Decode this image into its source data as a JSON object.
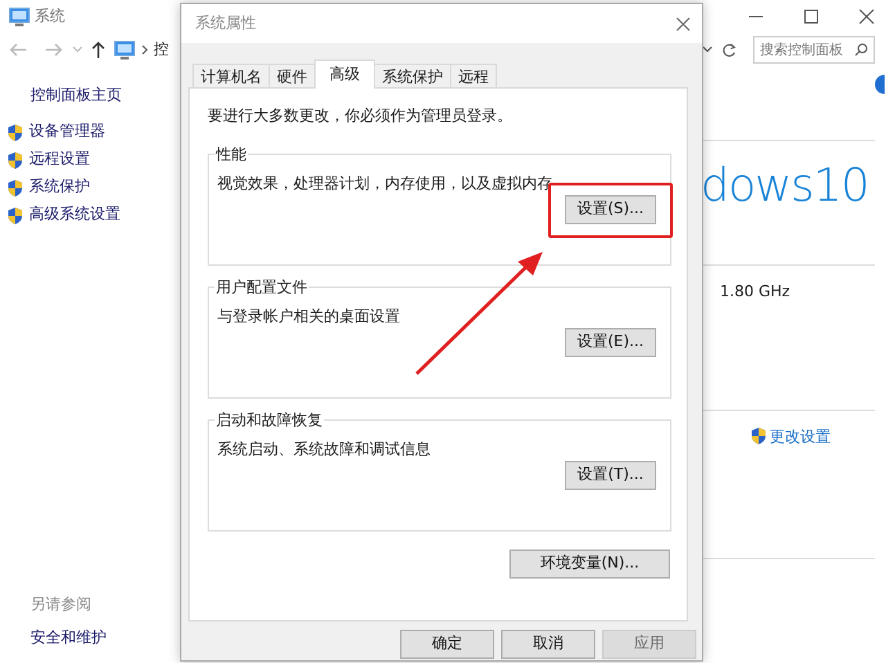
{
  "window": {
    "title": "系统",
    "breadcrumb": "控",
    "search": {
      "placeholder": "搜索控制面板"
    }
  },
  "sidebar": {
    "home": "控制面板主页",
    "items": [
      {
        "label": "设备管理器"
      },
      {
        "label": "远程设置"
      },
      {
        "label": "系统保护"
      },
      {
        "label": "高级系统设置"
      }
    ],
    "see_also": {
      "heading": "另请参阅",
      "items": [
        "安全和维护"
      ]
    }
  },
  "content": {
    "logo_text": "dows10",
    "processor_speed": "1.80 GHz",
    "change_settings": "更改设置"
  },
  "dialog": {
    "title": "系统属性",
    "tabs": [
      {
        "label": "计算机名",
        "selected": false
      },
      {
        "label": "硬件",
        "selected": false
      },
      {
        "label": "高级",
        "selected": true
      },
      {
        "label": "系统保护",
        "selected": false
      },
      {
        "label": "远程",
        "selected": false
      }
    ],
    "notice": "要进行大多数更改，你必须作为管理员登录。",
    "groups": [
      {
        "title": "性能",
        "description": "视觉效果，处理器计划，内存使用，以及虚拟内存",
        "button": "设置(S)...",
        "highlighted": true
      },
      {
        "title": "用户配置文件",
        "description": "与登录帐户相关的桌面设置",
        "button": "设置(E)...",
        "highlighted": false
      },
      {
        "title": "启动和故障恢复",
        "description": "系统启动、系统故障和调试信息",
        "button": "设置(T)...",
        "highlighted": false
      }
    ],
    "env_button": "环境变量(N)...",
    "buttons": [
      {
        "label": "确定",
        "disabled": false
      },
      {
        "label": "取消",
        "disabled": false
      },
      {
        "label": "应用",
        "disabled": true
      }
    ]
  }
}
